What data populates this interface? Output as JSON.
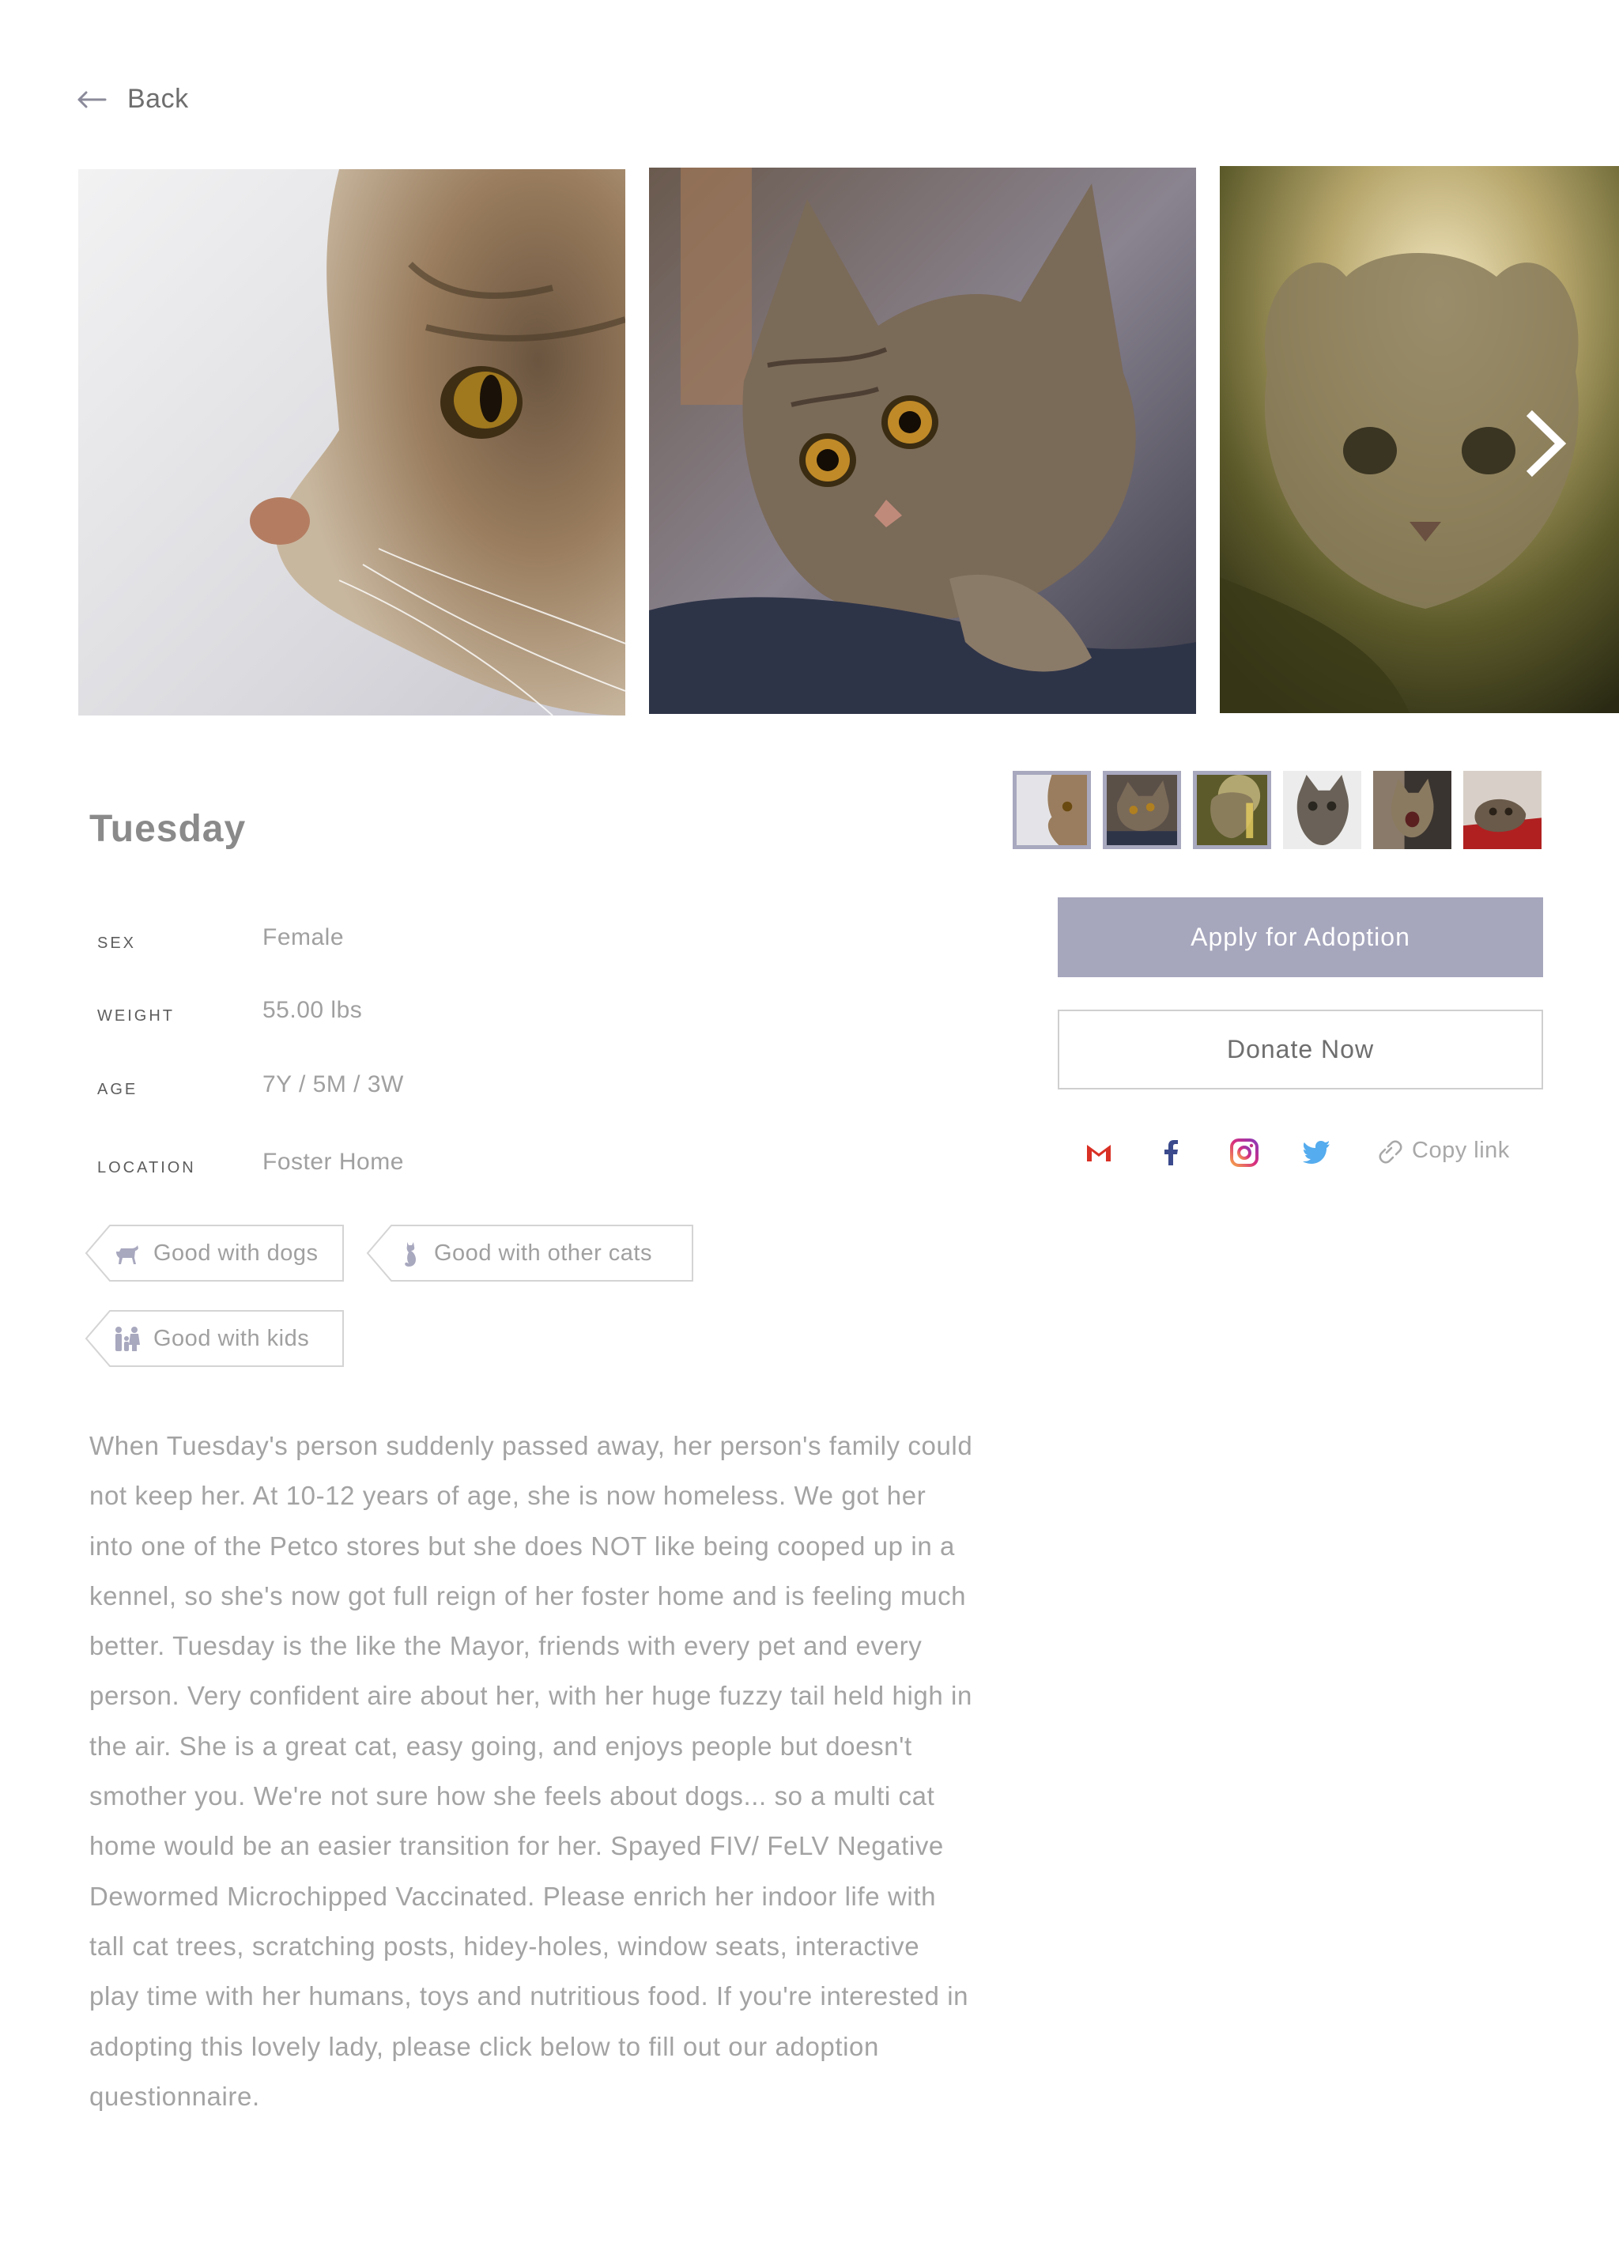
{
  "nav": {
    "back_label": "Back"
  },
  "gallery": {
    "photos": [
      "cat-profile-photo",
      "tabby-kitten-photo",
      "backlit-kitten-photo"
    ],
    "thumbnails": [
      "thumb-1",
      "thumb-2",
      "thumb-3",
      "thumb-4",
      "thumb-5",
      "thumb-6"
    ],
    "selected_thumbnail": 1
  },
  "pet": {
    "name": "Tuesday",
    "attributes": [
      {
        "label": "SEX",
        "value": "Female"
      },
      {
        "label": "WEIGHT",
        "value": "55.00 lbs"
      },
      {
        "label": "AGE",
        "value": "7Y / 5M / 3W"
      },
      {
        "label": "LOCATION",
        "value": "Foster Home"
      }
    ],
    "tags": [
      {
        "label": "Good with dogs",
        "icon": "dog-icon"
      },
      {
        "label": "Good with other cats",
        "icon": "cat-icon"
      },
      {
        "label": "Good with kids",
        "icon": "family-icon"
      }
    ],
    "description": "When Tuesday's person suddenly passed away, her person's family could not keep her. At 10-12 years of age, she is now homeless. We got her into one of the Petco stores but she does NOT like being cooped up in a kennel, so she's now got full reign of her foster home and is feeling much better. Tuesday is the like the Mayor, friends with every pet and every person. Very confident aire about her, with her huge fuzzy tail held high in the air. She is a great cat, easy going, and enjoys people but doesn't smother you. We're not sure how she feels about dogs... so a multi cat home would be an easier transition for her. Spayed FIV/ FeLV Negative Dewormed Microchipped Vaccinated. Please enrich her indoor life with tall cat trees, scratching posts, hidey-holes, window seats, interactive play time with her humans, toys and nutritious food. If you're interested in adopting this lovely lady, please click below to fill out our adoption questionnaire."
  },
  "actions": {
    "apply_label": "Apply for Adoption",
    "donate_label": "Donate Now",
    "copy_link_label": "Copy link"
  },
  "share": [
    "gmail-icon",
    "facebook-icon",
    "instagram-icon",
    "twitter-icon",
    "link-icon"
  ],
  "colors": {
    "accent": "#a6a6bd",
    "text": "#8a8a8a",
    "gmail": "#d93025",
    "facebook": "#3b4a8c",
    "instagram": "#c13584",
    "twitter": "#55acee"
  }
}
